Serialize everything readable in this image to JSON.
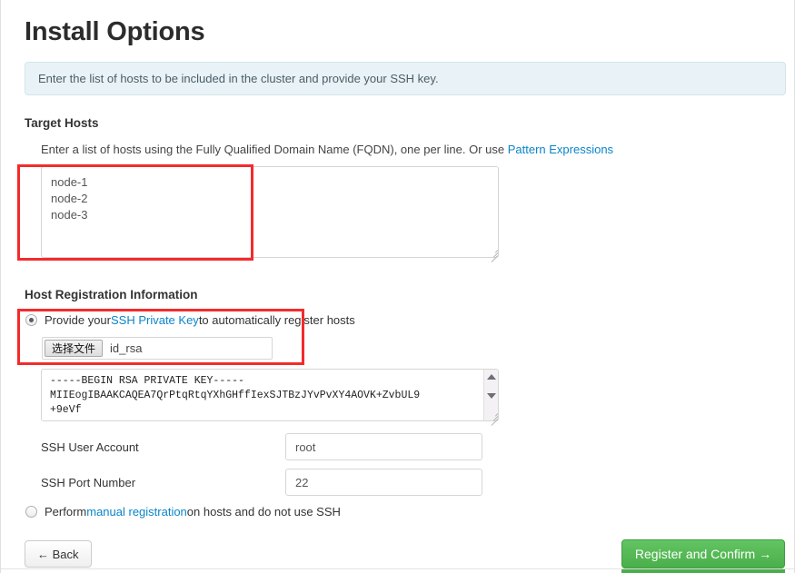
{
  "page": {
    "title": "Install Options",
    "info_banner": "Enter the list of hosts to be included in the cluster and provide your SSH key."
  },
  "target_hosts": {
    "heading": "Target Hosts",
    "help_prefix": "Enter a list of hosts using the Fully Qualified Domain Name (FQDN), one per line. Or use ",
    "help_link": "Pattern Expressions",
    "hosts_value": "node-1\nnode-2\nnode-3",
    "hosts_placeholder": ""
  },
  "host_registration": {
    "heading": "Host Registration Information",
    "ssh_option": {
      "prefix": "Provide your ",
      "link": "SSH Private Key",
      "suffix": " to automatically register hosts",
      "selected": true
    },
    "file_picker": {
      "button_label": "选择文件",
      "file_name": "id_rsa"
    },
    "ssh_key_text": "-----BEGIN RSA PRIVATE KEY-----\nMIIEogIBAAKCAQEA7QrPtqRtqYXhGHffIexSJTBzJYvPvXY4AOVK+ZvbUL9\n+9eVf",
    "ssh_user": {
      "label": "SSH User Account",
      "value": "root"
    },
    "ssh_port": {
      "label": "SSH Port Number",
      "value": "22"
    },
    "manual_option": {
      "prefix": "Perform ",
      "link": "manual registration",
      "suffix": " on hosts and do not use SSH",
      "selected": false
    }
  },
  "footer": {
    "back_label": "← Back",
    "confirm_label": "Register and Confirm →"
  },
  "colors": {
    "link": "#0a85c9",
    "highlight": "#f42b2b",
    "primary_button": "#4aaf4a",
    "banner_bg": "#e9f2f6"
  }
}
